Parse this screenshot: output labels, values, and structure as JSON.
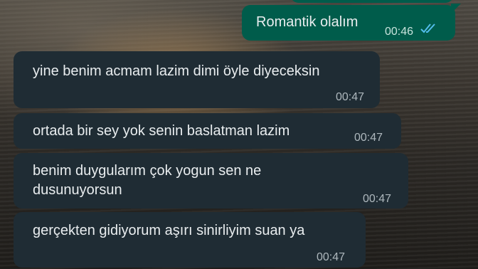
{
  "messages": [
    {
      "direction": "outgoing",
      "text": "Romantik olalım",
      "time": "00:46",
      "status_icon": "double-check-read-icon",
      "status_color": "#53bdeb"
    },
    {
      "direction": "incoming",
      "text": "yine benim acmam lazim dimi öyle diyeceksin",
      "time": "00:47"
    },
    {
      "direction": "incoming",
      "text": "ortada bir sey yok senin baslatman lazim",
      "time": "00:47"
    },
    {
      "direction": "incoming",
      "lines": [
        "benim duygularım çok yogun sen ne",
        "dusunuyorsun"
      ],
      "time": "00:47"
    },
    {
      "direction": "incoming",
      "text": "gerçekten gidiyorum aşırı sinirliyim suan ya",
      "time": "00:47"
    }
  ],
  "colors": {
    "incoming_bubble": "#1f2c34",
    "outgoing_bubble": "#005c4b",
    "text": "#e9edef",
    "timestamp": "#aeb8bd"
  }
}
